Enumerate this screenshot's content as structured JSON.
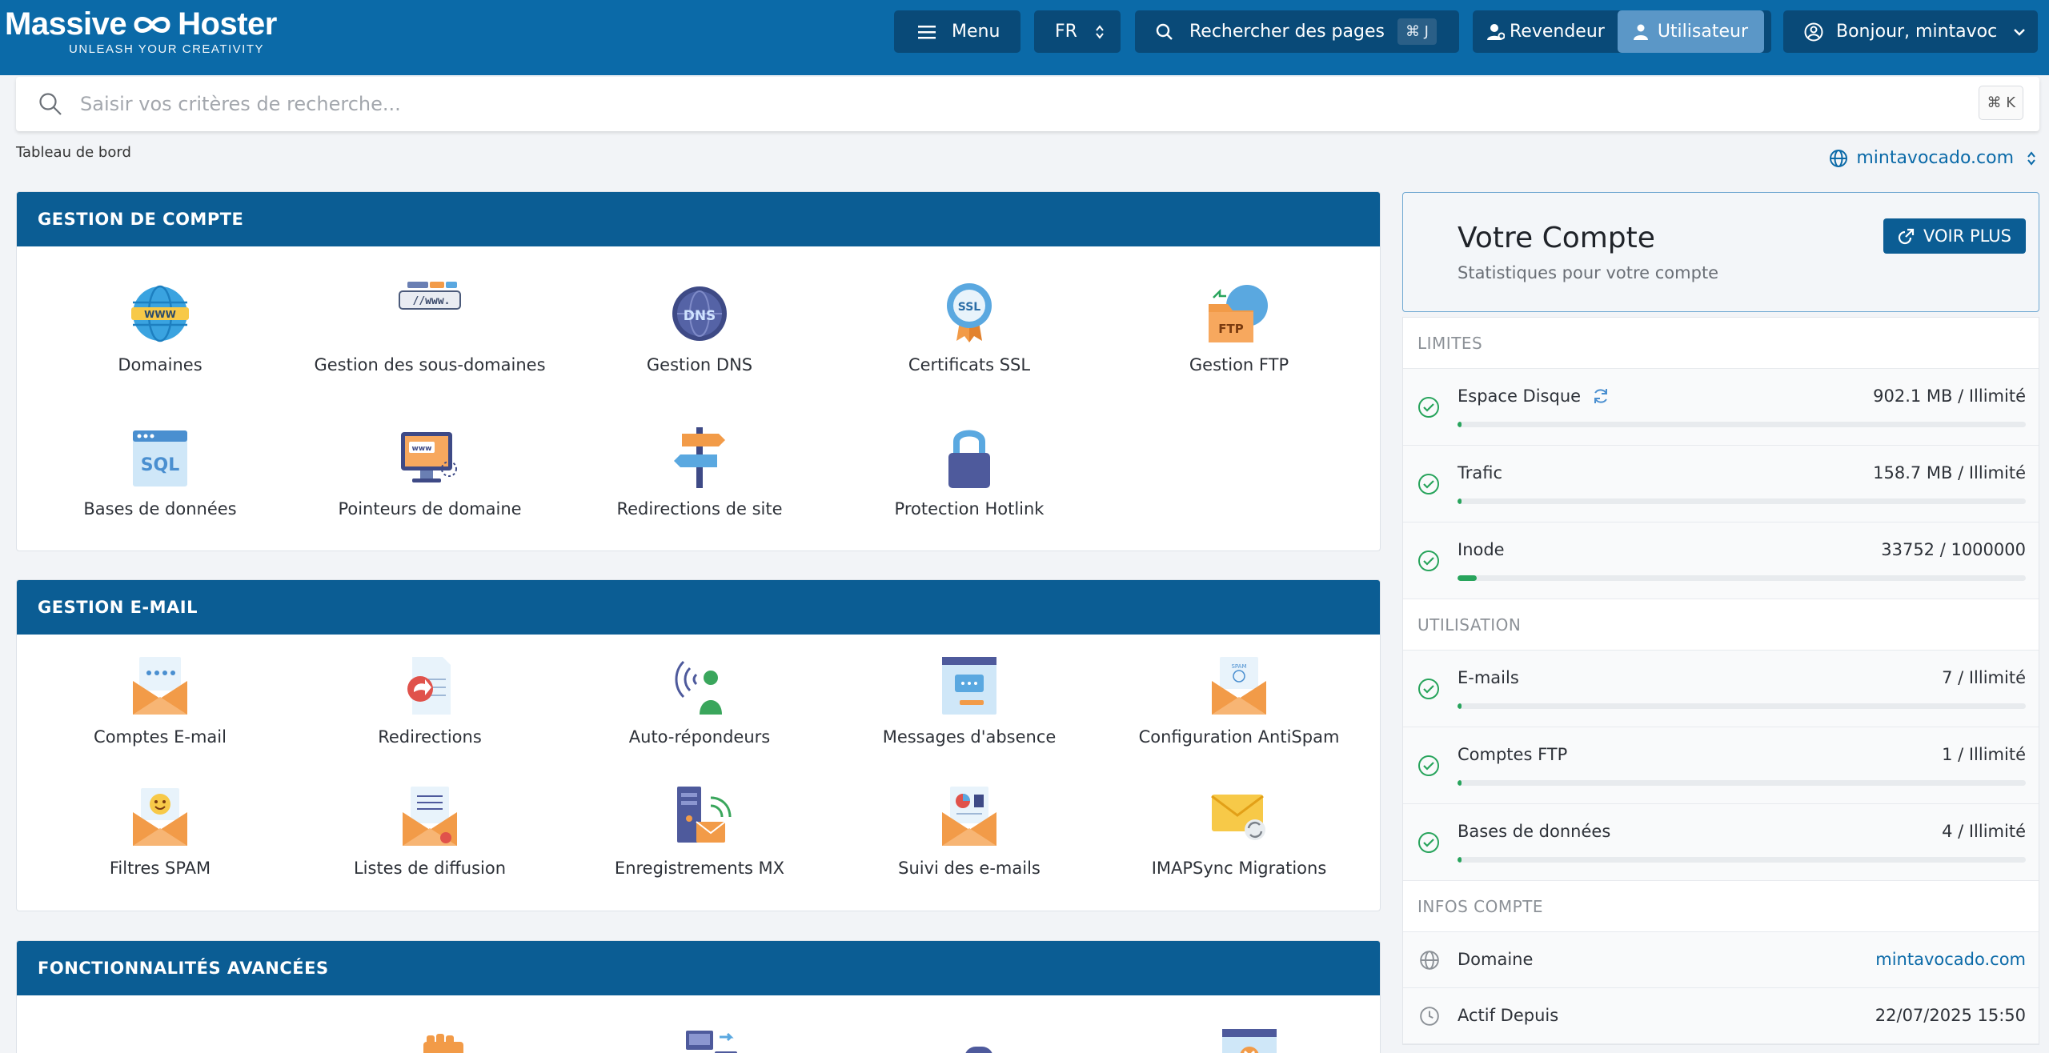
{
  "brand": {
    "name_left": "Massive",
    "name_right": "Hoster",
    "tagline": "UNLEASH YOUR CREATIVITY"
  },
  "topbar": {
    "menu_label": "Menu",
    "lang_label": "FR",
    "page_search_label": "Rechercher des pages",
    "page_search_shortcut": "⌘ J",
    "role_reseller": "Revendeur",
    "role_user": "Utilisateur",
    "greeting": "Bonjour, mintavoc"
  },
  "search": {
    "placeholder": "Saisir vos critères de recherche...",
    "shortcut": "⌘ K"
  },
  "breadcrumb": "Tableau de bord",
  "domain_selector": "mintavocado.com",
  "sections": {
    "account": {
      "title": "GESTION DE COMPTE",
      "items": [
        {
          "label": "Domaines",
          "icon": "globe-www-icon"
        },
        {
          "label": "Gestion des sous-domaines",
          "icon": "subdomain-icon"
        },
        {
          "label": "Gestion DNS",
          "icon": "dns-icon"
        },
        {
          "label": "Certificats SSL",
          "icon": "ssl-badge-icon"
        },
        {
          "label": "Gestion FTP",
          "icon": "ftp-folder-icon"
        },
        {
          "label": "Bases de données",
          "icon": "sql-database-icon"
        },
        {
          "label": "Pointeurs de domaine",
          "icon": "domain-pointer-icon"
        },
        {
          "label": "Redirections de site",
          "icon": "signpost-icon"
        },
        {
          "label": "Protection Hotlink",
          "icon": "padlock-icon"
        }
      ]
    },
    "email": {
      "title": "GESTION E-MAIL",
      "items": [
        {
          "label": "Comptes E-mail",
          "icon": "email-account-icon"
        },
        {
          "label": "Redirections",
          "icon": "email-forward-icon"
        },
        {
          "label": "Auto-répondeurs",
          "icon": "autoresponder-icon"
        },
        {
          "label": "Messages d'absence",
          "icon": "away-message-icon"
        },
        {
          "label": "Configuration AntiSpam",
          "icon": "antispam-icon"
        },
        {
          "label": "Filtres SPAM",
          "icon": "spam-filter-icon"
        },
        {
          "label": "Listes de diffusion",
          "icon": "mailing-list-icon"
        },
        {
          "label": "Enregistrements MX",
          "icon": "mx-record-icon"
        },
        {
          "label": "Suivi des e-mails",
          "icon": "email-tracking-icon"
        },
        {
          "label": "IMAPSync Migrations",
          "icon": "imapsync-icon"
        }
      ]
    },
    "advanced": {
      "title": "FONCTIONNALITÉS AVANCÉES"
    }
  },
  "account_card": {
    "title": "Votre Compte",
    "subtitle": "Statistiques pour votre compte",
    "more_button": "VOIR PLUS"
  },
  "limits": {
    "title": "LIMITES",
    "rows": [
      {
        "name": "Espace Disque",
        "value": "902.1 MB / Illimité",
        "progress_pct": 0.6
      },
      {
        "name": "Trafic",
        "value": "158.7 MB / Illimité",
        "progress_pct": 0.6
      },
      {
        "name": "Inode",
        "value": "33752 / 1000000",
        "progress_pct": 3.4
      }
    ]
  },
  "usage": {
    "title": "UTILISATION",
    "rows": [
      {
        "name": "E-mails",
        "value": "7 / Illimité",
        "progress_pct": 0.6
      },
      {
        "name": "Comptes FTP",
        "value": "1 / Illimité",
        "progress_pct": 0.6
      },
      {
        "name": "Bases de données",
        "value": "4 / Illimité",
        "progress_pct": 0.6
      }
    ]
  },
  "account_info": {
    "title": "INFOS COMPTE",
    "rows": [
      {
        "name": "Domaine",
        "value": "mintavocado.com"
      },
      {
        "name": "Actif Depuis",
        "value": "22/07/2025 15:50"
      }
    ]
  },
  "colors": {
    "topbar": "#0b6aa8",
    "panel_header": "#0b5d94",
    "success": "#28a45c",
    "link": "#0b6aa8"
  }
}
